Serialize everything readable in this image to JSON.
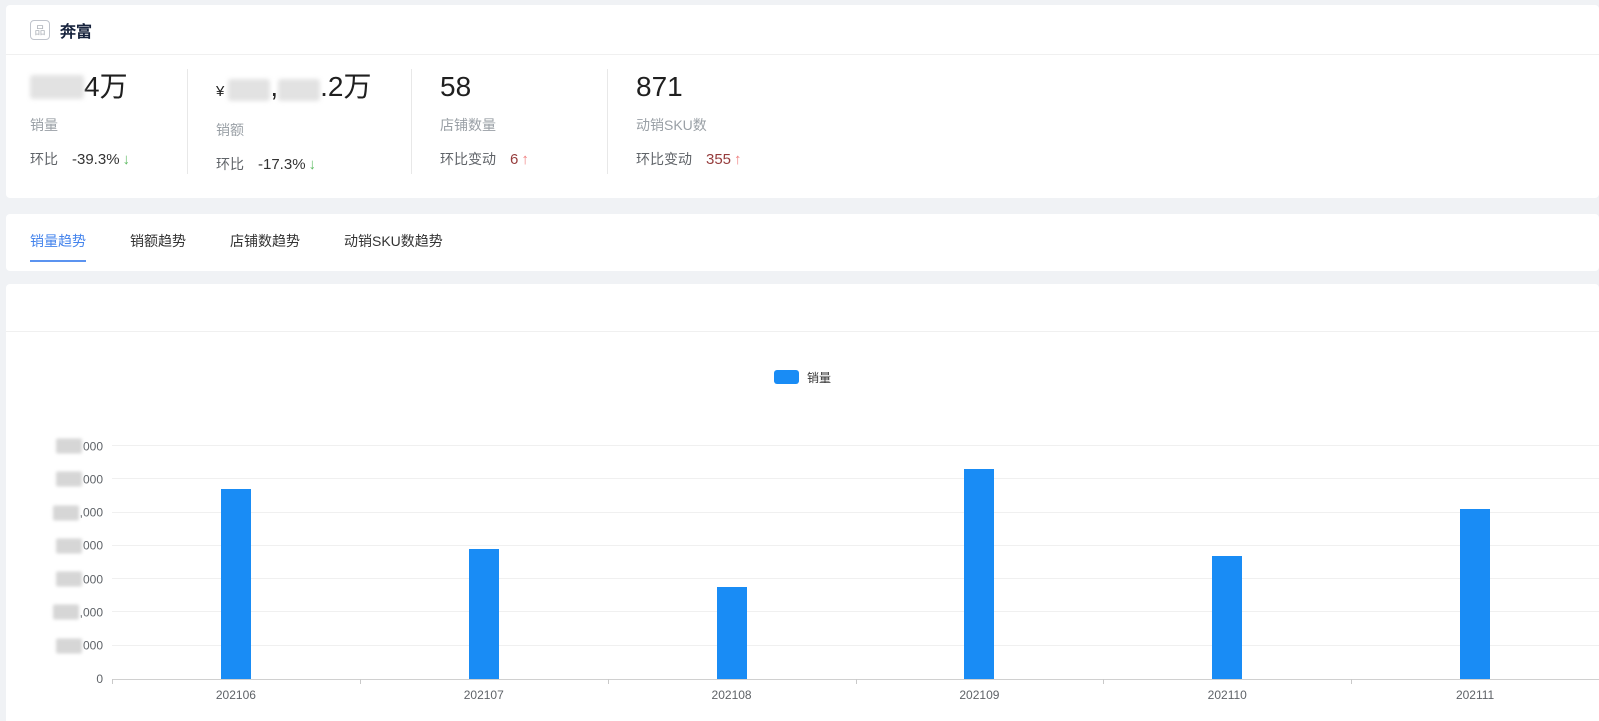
{
  "header": {
    "brand": "奔富"
  },
  "stats": [
    {
      "value_masked": true,
      "value_suffix": "4万",
      "label": "销量",
      "mom_label": "环比",
      "mom_value": "-39.3%",
      "direction": "down",
      "arrow": "↓"
    },
    {
      "value_masked": true,
      "currency": "¥",
      "separator": ",",
      "value_suffix": ".2万",
      "label": "销额",
      "mom_label": "环比",
      "mom_value": "-17.3%",
      "direction": "down",
      "arrow": "↓"
    },
    {
      "value": "58",
      "label": "店铺数量",
      "mom_label": "环比变动",
      "mom_value": "6",
      "direction": "up",
      "arrow": "↑"
    },
    {
      "value": "871",
      "label": "动销SKU数",
      "mom_label": "环比变动",
      "mom_value": "355",
      "direction": "up",
      "arrow": "↑"
    }
  ],
  "tabs": [
    {
      "label": "销量趋势",
      "active": true
    },
    {
      "label": "销额趋势",
      "active": false
    },
    {
      "label": "店铺数趋势",
      "active": false
    },
    {
      "label": "动销SKU数趋势",
      "active": false
    }
  ],
  "chart_data": {
    "type": "bar",
    "title": "",
    "categories": [
      "202106",
      "202107",
      "202108",
      "202109",
      "202110",
      "202111"
    ],
    "values": [
      5720,
      3910,
      2750,
      6310,
      3710,
      5120
    ],
    "series": [
      {
        "name": "销量",
        "values": [
          5720,
          3910,
          2750,
          6310,
          3710,
          5120
        ]
      }
    ],
    "legend": [
      "销量"
    ],
    "legend_position": "top-center",
    "xlabel": "",
    "ylabel": "",
    "ylim": [
      0,
      7000
    ],
    "y_tick_step": 1000,
    "grid": true,
    "y_tick_labels_masked": true,
    "y_tick_visible_suffixes": [
      "0",
      "000",
      ",000",
      "000",
      "000",
      ",000",
      "000",
      "000"
    ],
    "bar_color": "#198cf5"
  },
  "colors": {
    "accent_blue": "#4584ec",
    "bar_blue": "#198cf5",
    "up_red": "#f07d7d",
    "down_green": "#5dbb63",
    "card_bg": "#ffffff",
    "page_bg": "#f0f2f5"
  }
}
